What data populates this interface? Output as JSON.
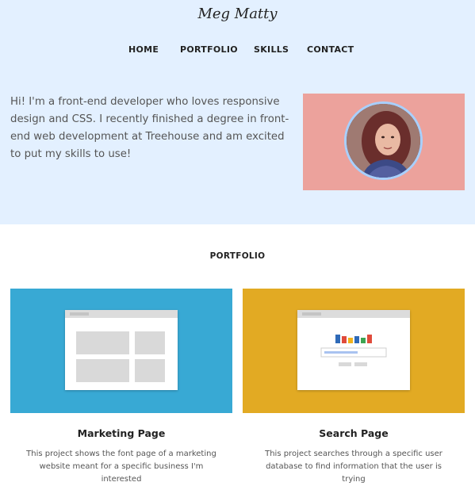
{
  "site": {
    "title": "Meg Matty"
  },
  "nav": {
    "items": [
      "HOME",
      "PORTFOLIO",
      "SKILLS",
      "CONTACT"
    ]
  },
  "hero": {
    "intro": "Hi! I'm a front-end developer who loves responsive design and CSS. I recently finished a degree in front-end web development at Treehouse and am excited to put my skills to use!",
    "photo_bg": "#eca29c",
    "avatar_border": "#a8d0ff",
    "background": "#e3f0ff"
  },
  "portfolio": {
    "heading": "PORTFOLIO",
    "projects": [
      {
        "title": "Marketing Page",
        "description": "This project shows the font page of a marketing website meant for a specific business I'm interested",
        "card_color": "#38a9d4",
        "icon": "webpage-layout-icon"
      },
      {
        "title": "Search Page",
        "description": "This project searches through a specific user database to find information that the user is trying",
        "card_color": "#e2aa23",
        "icon": "search-page-icon"
      }
    ]
  }
}
